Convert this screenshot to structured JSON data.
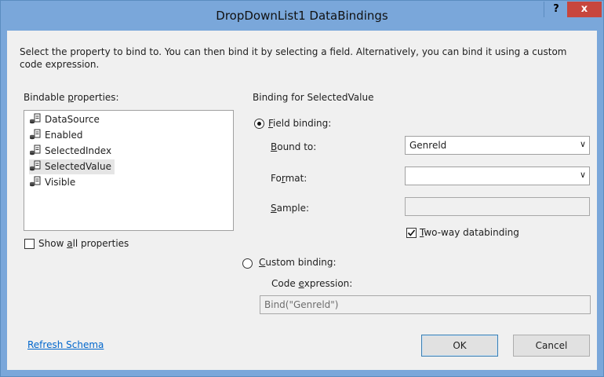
{
  "window": {
    "title": "DropDownList1 DataBindings",
    "help_label": "?",
    "close_label": "x"
  },
  "description": "Select the property to bind to. You can then bind it by selecting a field. Alternatively, you can bind it using a custom code expression.",
  "bindable": {
    "label_pre": "Bindable ",
    "label_u": "p",
    "label_post": "roperties:",
    "items": [
      "DataSource",
      "Enabled",
      "SelectedIndex",
      "SelectedValue",
      "Visible"
    ],
    "selected_index": 3
  },
  "show_all": {
    "pre": "Show ",
    "u": "a",
    "post": "ll properties",
    "checked": false
  },
  "binding": {
    "heading": "Binding for SelectedValue",
    "field_binding": {
      "u": "F",
      "post": "ield binding:",
      "selected": true
    },
    "bound_to": {
      "u": "B",
      "post": "ound to:",
      "value": "Genreld"
    },
    "format": {
      "pre": "Fo",
      "u": "r",
      "post": "mat:",
      "value": ""
    },
    "sample": {
      "u": "S",
      "post": "ample:",
      "value": ""
    },
    "two_way": {
      "u": "T",
      "post": "wo-way databinding",
      "checked": true
    },
    "custom_binding": {
      "u": "C",
      "post": "ustom binding:",
      "selected": false
    },
    "code_expression": {
      "pre": "Code ",
      "u": "e",
      "post": "xpression:",
      "value": "Bind(\"Genreld\")"
    }
  },
  "footer": {
    "refresh_link": "Refresh Schema",
    "ok": "OK",
    "cancel": "Cancel"
  },
  "colors": {
    "titlebar": "#7aa7da",
    "close": "#c7463d",
    "dialog_bg": "#f0f0f0",
    "link": "#0066cc"
  }
}
